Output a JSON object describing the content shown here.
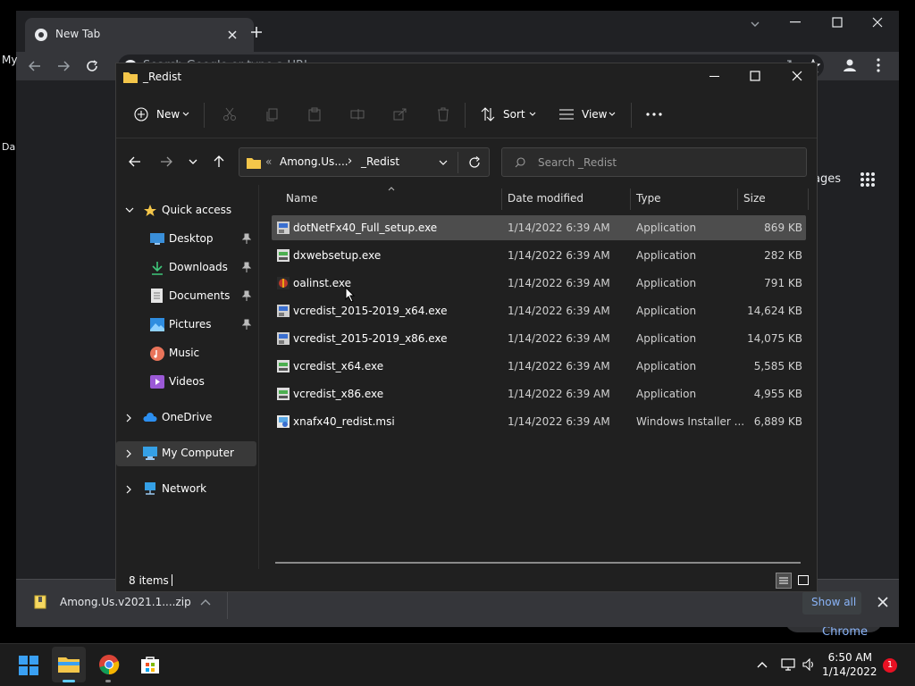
{
  "chrome": {
    "tab_title": "New Tab",
    "omnibox_placeholder": "Search Google or type a URL",
    "images_link": "ages",
    "customize_label": "ze Chrome",
    "shortcut_1": "My",
    "shortcut_2": "Da",
    "download": {
      "file_name": "Among.Us.v2021.1....zip",
      "show_all_label": "Show all"
    }
  },
  "explorer": {
    "title": "_Redist",
    "toolbar": {
      "new_label": "New",
      "sort_label": "Sort",
      "view_label": "View"
    },
    "address": {
      "crumb_collapsed": "«",
      "crumb_1": "Among.Us....",
      "separator": "›",
      "crumb_2": "_Redist"
    },
    "search_placeholder": "Search _Redist",
    "nav": {
      "quick_access": "Quick access",
      "desktop": "Desktop",
      "downloads": "Downloads",
      "documents": "Documents",
      "pictures": "Pictures",
      "music": "Music",
      "videos": "Videos",
      "onedrive": "OneDrive",
      "my_computer": "My Computer",
      "network": "Network"
    },
    "columns": {
      "name": "Name",
      "date": "Date modified",
      "type": "Type",
      "size": "Size"
    },
    "files": [
      {
        "name": "dotNetFx40_Full_setup.exe",
        "date": "1/14/2022 6:39 AM",
        "type": "Application",
        "size": "869 KB"
      },
      {
        "name": "dxwebsetup.exe",
        "date": "1/14/2022 6:39 AM",
        "type": "Application",
        "size": "282 KB"
      },
      {
        "name": "oalinst.exe",
        "date": "1/14/2022 6:39 AM",
        "type": "Application",
        "size": "791 KB"
      },
      {
        "name": "vcredist_2015-2019_x64.exe",
        "date": "1/14/2022 6:39 AM",
        "type": "Application",
        "size": "14,624 KB"
      },
      {
        "name": "vcredist_2015-2019_x86.exe",
        "date": "1/14/2022 6:39 AM",
        "type": "Application",
        "size": "14,075 KB"
      },
      {
        "name": "vcredist_x64.exe",
        "date": "1/14/2022 6:39 AM",
        "type": "Application",
        "size": "5,585 KB"
      },
      {
        "name": "vcredist_x86.exe",
        "date": "1/14/2022 6:39 AM",
        "type": "Application",
        "size": "4,955 KB"
      },
      {
        "name": "xnafx40_redist.msi",
        "date": "1/14/2022 6:39 AM",
        "type": "Windows Installer ...",
        "size": "6,889 KB"
      }
    ],
    "status": "8 items"
  },
  "taskbar": {
    "time": "6:50 AM",
    "date": "1/14/2022",
    "notification_count": "1"
  }
}
